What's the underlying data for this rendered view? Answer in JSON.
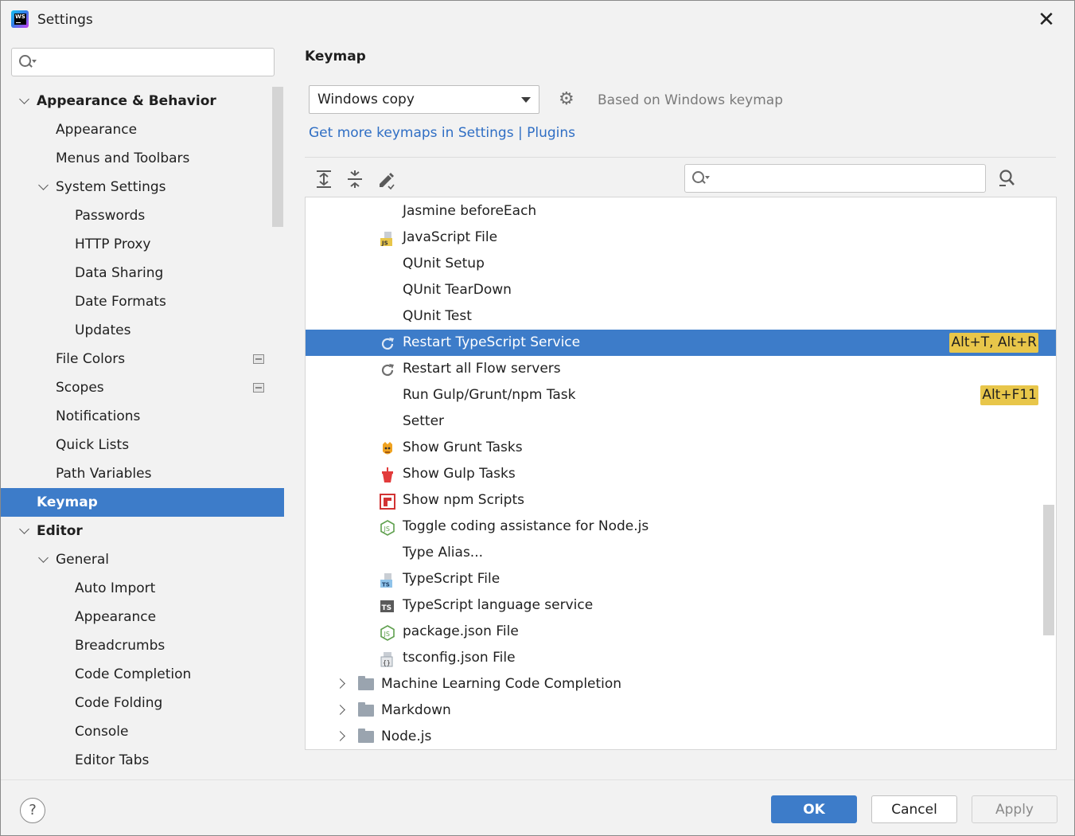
{
  "window": {
    "title": "Settings",
    "app_icon_text": "WS"
  },
  "sidebar": {
    "search_placeholder": "",
    "items": [
      {
        "label": "Appearance & Behavior",
        "level": 0,
        "expanded": true,
        "bold": true
      },
      {
        "label": "Appearance",
        "level": 1
      },
      {
        "label": "Menus and Toolbars",
        "level": 1
      },
      {
        "label": "System Settings",
        "level": 1,
        "expanded": true
      },
      {
        "label": "Passwords",
        "level": 2
      },
      {
        "label": "HTTP Proxy",
        "level": 2
      },
      {
        "label": "Data Sharing",
        "level": 2
      },
      {
        "label": "Date Formats",
        "level": 2
      },
      {
        "label": "Updates",
        "level": 2
      },
      {
        "label": "File Colors",
        "level": 1,
        "project_icon": true
      },
      {
        "label": "Scopes",
        "level": 1,
        "project_icon": true
      },
      {
        "label": "Notifications",
        "level": 1
      },
      {
        "label": "Quick Lists",
        "level": 1
      },
      {
        "label": "Path Variables",
        "level": 1
      },
      {
        "label": "Keymap",
        "level": 0,
        "selected": true
      },
      {
        "label": "Editor",
        "level": 0,
        "expanded": true,
        "bold": true
      },
      {
        "label": "General",
        "level": 1,
        "expanded": true
      },
      {
        "label": "Auto Import",
        "level": 2
      },
      {
        "label": "Appearance",
        "level": 2
      },
      {
        "label": "Breadcrumbs",
        "level": 2
      },
      {
        "label": "Code Completion",
        "level": 2
      },
      {
        "label": "Code Folding",
        "level": 2
      },
      {
        "label": "Console",
        "level": 2
      },
      {
        "label": "Editor Tabs",
        "level": 2
      }
    ]
  },
  "content": {
    "title": "Keymap",
    "keymap_select_value": "Windows copy",
    "based_on": "Based on Windows keymap",
    "link_settings": "Get more keymaps in Settings",
    "link_separator": " | ",
    "link_plugins": "Plugins",
    "action_search_placeholder": ""
  },
  "actions": [
    {
      "label": "Jasmine beforeEach",
      "icon": "none"
    },
    {
      "label": "JavaScript File",
      "icon": "js-file-icon"
    },
    {
      "label": "QUnit Setup",
      "icon": "none"
    },
    {
      "label": "QUnit TearDown",
      "icon": "none"
    },
    {
      "label": "QUnit Test",
      "icon": "none"
    },
    {
      "label": "Restart TypeScript Service",
      "icon": "restart-icon",
      "selected": true,
      "shortcut": "Alt+T, Alt+R"
    },
    {
      "label": "Restart all Flow servers",
      "icon": "restart-icon"
    },
    {
      "label": "Run Gulp/Grunt/npm Task",
      "icon": "none",
      "shortcut": "Alt+F11"
    },
    {
      "label": "Setter",
      "icon": "none"
    },
    {
      "label": "Show Grunt Tasks",
      "icon": "grunt-icon"
    },
    {
      "label": "Show Gulp Tasks",
      "icon": "gulp-icon"
    },
    {
      "label": "Show npm Scripts",
      "icon": "npm-icon"
    },
    {
      "label": "Toggle coding assistance for Node.js",
      "icon": "nodejs-icon"
    },
    {
      "label": "Type Alias...",
      "icon": "none"
    },
    {
      "label": "TypeScript File",
      "icon": "ts-file-icon"
    },
    {
      "label": "TypeScript language service",
      "icon": "ts-service-icon"
    },
    {
      "label": "package.json File",
      "icon": "nodejs-icon"
    },
    {
      "label": "tsconfig.json File",
      "icon": "tsconfig-icon"
    },
    {
      "label": "Machine Learning Code Completion",
      "icon": "folder-icon",
      "group": true
    },
    {
      "label": "Markdown",
      "icon": "folder-icon",
      "group": true
    },
    {
      "label": "Node.js",
      "icon": "folder-icon",
      "group": true
    }
  ],
  "footer": {
    "help": "?",
    "ok": "OK",
    "cancel": "Cancel",
    "apply": "Apply"
  },
  "colors": {
    "selection": "#3d7cc9",
    "shortcut_highlight": "#e8c64a",
    "link": "#2f6ec4"
  }
}
